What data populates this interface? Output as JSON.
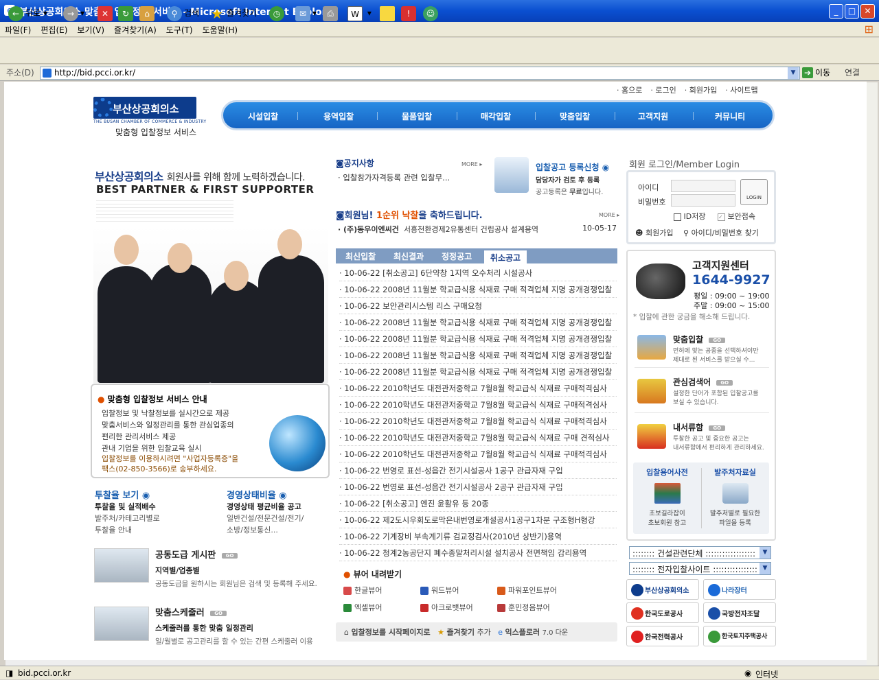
{
  "window": {
    "title": "부산상공회의소 맞춤형 입찰정보 서비스 - Microsoft Internet Explorer"
  },
  "menu": [
    "파일(F)",
    "편집(E)",
    "보기(V)",
    "즐겨찾기(A)",
    "도구(T)",
    "도움말(H)"
  ],
  "toolbar": {
    "back": "뒤로",
    "search": "검색",
    "favorites": "즐겨찾기"
  },
  "address": {
    "label": "주소(D)",
    "url": "http://bid.pcci.or.kr/",
    "go": "이동",
    "links": "연결"
  },
  "status": {
    "url": "bid.pcci.or.kr",
    "zone": "인터넷"
  },
  "toplinks": [
    "· 홈으로",
    "· 로그인",
    "· 회원가입",
    "· 사이트맵"
  ],
  "logo": {
    "name": "부산상공회의소",
    "sub": "THE BUSAN CHAMBER OF COMMERCE & INDUSTRY",
    "caption": "맞춤형 입찰정보 서비스"
  },
  "nav": [
    "시설입찰",
    "용역입찰",
    "물품입찰",
    "매각입찰",
    "맞춤입찰",
    "고객지원",
    "커뮤니티"
  ],
  "hero": {
    "line1": "부산상공회의소",
    "line1b": "회원사를 위해 함께 노력하겠습니다.",
    "line2": "BEST PARTNER & FIRST SUPPORTER"
  },
  "service": {
    "title": "맞춤형 입찰정보 서비스 안내",
    "lines": [
      "입찰정보 및 낙찰정보를 실시간으로 제공",
      "맞춤서비스와 일정관리를 통한 관심업종의",
      "편리한 관리서비스 제공",
      "관내 기업을 위한 입찰교육 실시"
    ],
    "note1": "입찰정보를 이용하시려면 \"사업자등록증\"을",
    "note2": "팩스(02-850-3566)로 송부하세요."
  },
  "rate": {
    "title": "투찰율 보기",
    "l1": "투찰율 및 실적배수",
    "l2": "발주처/카테고리별로",
    "l3": "투찰율 안내"
  },
  "mgmt": {
    "title": "경영상태비율",
    "l1": "경영상태 평균비율 공고",
    "l2": "일반건설/전문건설/전기/",
    "l3": "소방/정보통신..."
  },
  "board": {
    "title": "공동도급 게시판",
    "sub": "지역별/업종별",
    "desc": "공동도급을 원하시는 회원님은 검색 및 등록해 주세요."
  },
  "sched": {
    "title": "맞춤스케줄러",
    "sub": "스케줄러를 통한 맞춤 일정관리",
    "desc": "일/월별로 공고관리를 할 수 있는 간편 스케줄러 이용"
  },
  "notice": {
    "title": "공지사항",
    "more": "MORE ▸",
    "item": "· 입찰참가자격등록 관련 입찰무..."
  },
  "register": {
    "title": "입찰공고 등록신청",
    "l1": "담당자가 검토 후 등록",
    "l2": "공고등록은",
    "l2b": "무료",
    "l2c": "입니다."
  },
  "congrats": {
    "prefix": "회원님!",
    "highlight": "1순위 낙찰",
    "suffix": "을 축하드립니다.",
    "more": "MORE ▸",
    "company": "· (주)동우이엔씨건",
    "item": "서흥천환경제2유통센터 건립공사 설계용역",
    "date": "10-05-17"
  },
  "tabs": [
    "최신입찰",
    "최신결과",
    "정정공고",
    "취소공고"
  ],
  "bids": [
    "· 10-06-22 [취소공고] 6단약창 1지역 오수처리 시설공사",
    "· 10-06-22 2008년 11월분 학교급식용 식재료 구매 적격업체 지명 공개경쟁입찰",
    "· 10-06-22 보안관리시스템 리스 구매요청",
    "· 10-06-22 2008년 11월분 학교급식용 식재료 구매 적격업체 지명 공개경쟁입찰",
    "· 10-06-22 2008년 11월분 학교급식용 식재료 구매 적격업체 지명 공개경쟁입찰",
    "· 10-06-22 2008년 11월분 학교급식용 식재료 구매 적격업체 지명 공개경쟁입찰",
    "· 10-06-22 2008년 11월분 학교급식용 식재료 구매 적격업체 지명 공개경쟁입찰",
    "· 10-06-22 2010학년도 대전관저중학교 7월8월 학교급식 식재료 구매적격심사",
    "· 10-06-22 2010학년도 대전관저중학교 7월8월 학교급식 식재료 구매적격심사",
    "· 10-06-22 2010학년도 대전관저중학교 7월8월 학교급식 식재료 구매적격심사",
    "· 10-06-22 2010학년도 대전관저중학교 7월8월 학교급식 식재료 구매 견적심사",
    "· 10-06-22 2010학년도 대전관저중학교 7월8월 학교급식 식재료 구매적격심사",
    "· 10-06-22 번영로 표선-성읍간 전기시설공사 1공구 관급자재 구입",
    "· 10-06-22 번영로 표선-성읍간 전기시설공사 2공구 관급자재 구입",
    "· 10-06-22 [취소공고] 엔진 윤활유 등 20종",
    "· 10-06-22 제2도시우회도로막은내번영로개설공사1공구1차분 구조형H형강",
    "· 10-06-22 기계장비 부속계기류 검교정검사(2010년 상반기)용역",
    "· 10-06-22 청계2농공단지 폐수종말처리시설 설치공사 전면책임 감리용역"
  ],
  "viewers": {
    "title": "뷰어 내려받기",
    "items": [
      "한글뷰어",
      "워드뷰어",
      "파워포인트뷰어",
      "엑셀뷰어",
      "아크로뱃뷰어",
      "훈민정음뷰어"
    ]
  },
  "bottombar": {
    "start": "입찰정보를 시작페이지로",
    "fav": "즐겨찾기",
    "add": "추가",
    "ie": "익스플로러",
    "ie_ver": "7.0 다운"
  },
  "login": {
    "title": "회원 로그인/Member Login",
    "id": "아이디",
    "pw": "비밀번호",
    "btn": "LOGIN",
    "save": "ID저장",
    "secure": "보안접속",
    "join": "회원가입",
    "find": "아이디/비밀번호 찾기"
  },
  "support": {
    "title": "고객지원센터",
    "phone": "1644-9927",
    "weekday": "평일 : 09:00 ~ 19:00",
    "weekend": "주말 : 09:00 ~ 15:00",
    "note": "* 입찰에 관한 궁금을 해소해 드립니다."
  },
  "services": [
    {
      "t": "맞춤입찰",
      "d1": "먼허에 맞는 공종을 선택하셔야만",
      "d2": "제대로 된 서비스를 받으실 수..."
    },
    {
      "t": "관심검색어",
      "d1": "설정한 단어가 포함된 입찰공고를",
      "d2": "보실 수 있습니다."
    },
    {
      "t": "내서류함",
      "d1": "투찰한 공고 및 중요한 공고는",
      "d2": "내서류함에서 편리하게 관리하세요."
    }
  ],
  "go": "GO",
  "dict": {
    "title": "입찰용어사전",
    "l1": "초보길라잡이",
    "l2": "초보회원 참고"
  },
  "client": {
    "title": "발주처자료실",
    "l1": "발주처별로 필요한",
    "l2": "파일을 등록"
  },
  "selects": [
    ":::::::: 건설관련단체 ::::::::::::::::::",
    ":::::::: 전자입찰사이트 ::::::::::::::::"
  ],
  "banners": [
    "부산상공회의소",
    "나라장터",
    "한국도로공사",
    "국방전자조달",
    "한국전력공사",
    "한국토지주택공사"
  ],
  "colors": {
    "nav": "#1664c4",
    "accent": "#1a3f8a",
    "highlight": "#e05000"
  }
}
